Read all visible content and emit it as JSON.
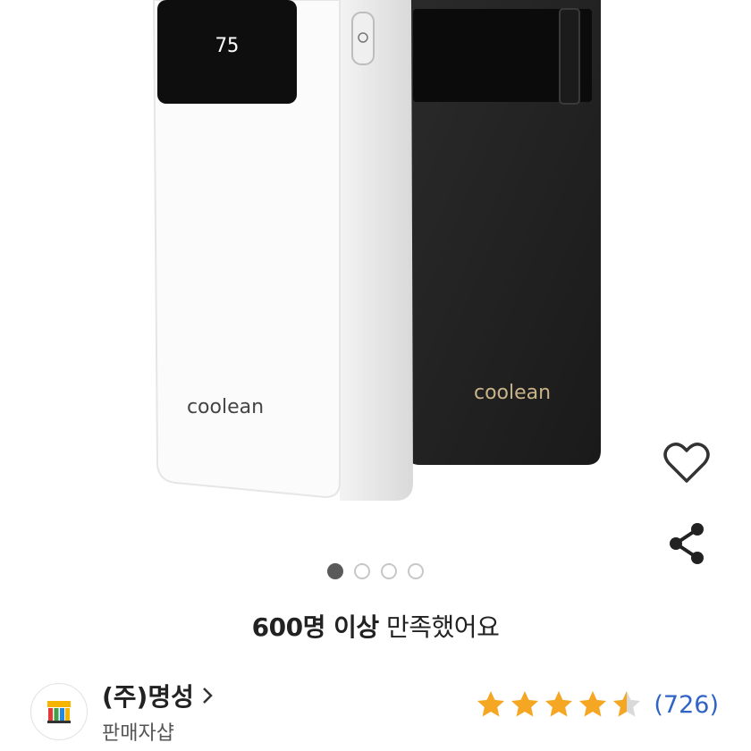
{
  "product": {
    "brand_logo_text": "coolean",
    "display_value": "75",
    "image_dots": {
      "total": 4,
      "active_index": 0
    }
  },
  "actions": {
    "like_icon": "heart-icon",
    "share_icon": "share-icon"
  },
  "satisfaction": {
    "bold_text": "600명 이상",
    "rest_text": "만족했어요"
  },
  "seller": {
    "name": "(주)명성",
    "type": "판매자샵",
    "logo_colors": [
      "#f4b400",
      "#e53935",
      "#43a047",
      "#1e88e5"
    ]
  },
  "rating": {
    "stars": 4.5,
    "count_text": "(726)",
    "star_color": "#f5a623"
  }
}
